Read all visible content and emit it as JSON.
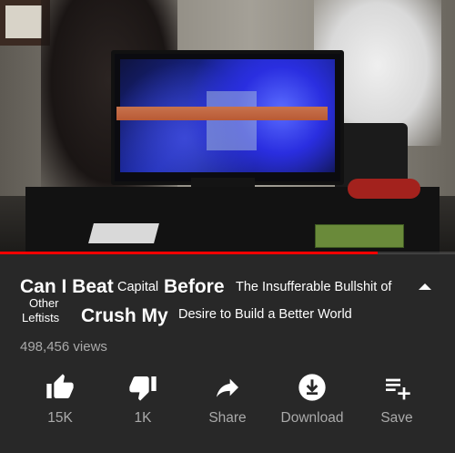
{
  "video": {
    "progress_fraction": 0.83
  },
  "title": {
    "can_i_beat": "Can I Beat",
    "capital": "Capital",
    "before": "Before",
    "insufferable": "The Insufferable Bullshit of",
    "other": "Other",
    "leftists": "Leftists",
    "crush_my": "Crush My",
    "desire": "Desire to Build a Better World"
  },
  "views": "498,456 views",
  "actions": {
    "like": {
      "label": "15K",
      "icon": "thumbs-up-icon"
    },
    "dislike": {
      "label": "1K",
      "icon": "thumbs-down-icon"
    },
    "share": {
      "label": "Share",
      "icon": "share-arrow-icon"
    },
    "download": {
      "label": "Download",
      "icon": "download-icon"
    },
    "save": {
      "label": "Save",
      "icon": "playlist-add-icon"
    }
  },
  "colors": {
    "background": "#282828",
    "progress": "#ff0000",
    "secondary_text": "#aaaaaa",
    "icon": "#ffffff"
  }
}
